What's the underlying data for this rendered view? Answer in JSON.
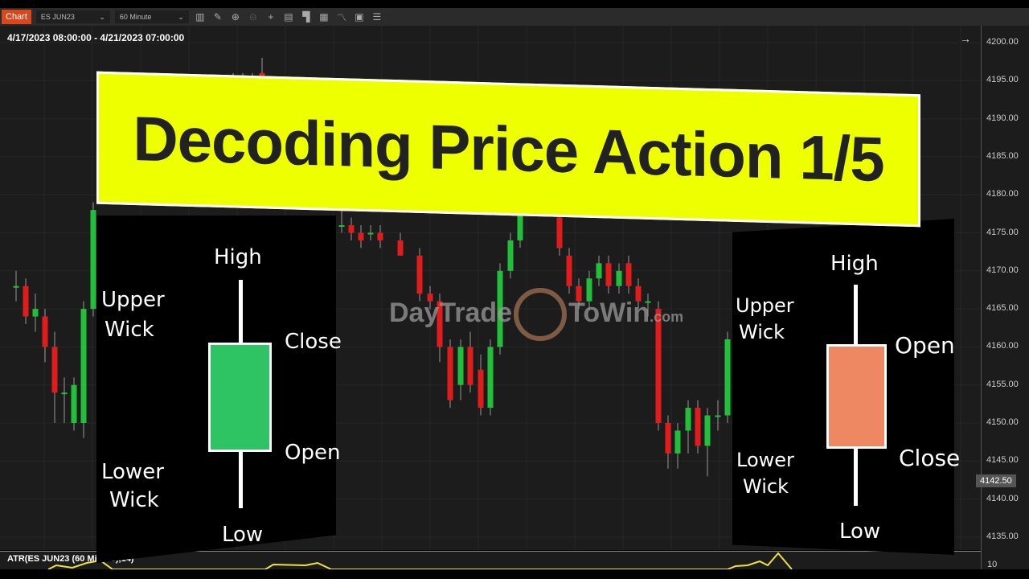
{
  "toolbar": {
    "tab": "Chart",
    "instrument": "ES JUN23",
    "interval": "60 Minute",
    "icons": [
      "bar-type-icon",
      "pencil-icon",
      "zoom-in-icon",
      "zoom-out-icon",
      "crosshair-icon",
      "data-box-icon",
      "properties-icon",
      "strategy-icon",
      "indicator-icon",
      "chart-trader-icon",
      "list-icon"
    ]
  },
  "chart": {
    "range": "4/17/2023 08:00:00 - 4/21/2023 07:00:00",
    "current_price": "4142.50",
    "y_ticks": [
      "4200.00",
      "4195.00",
      "4190.00",
      "4185.00",
      "4180.00",
      "4175.00",
      "4170.00",
      "4165.00",
      "4160.00",
      "4155.00",
      "4150.00",
      "4145.00",
      "4140.00",
      "4135.00"
    ],
    "colors": {
      "up": "#22c03a",
      "down": "#e01c1c",
      "atr": "#f0e040"
    },
    "candles": [
      [
        4168,
        4170,
        4166,
        4168
      ],
      [
        4168,
        4169,
        4163,
        4164
      ],
      [
        4164,
        4167,
        4162,
        4165
      ],
      [
        4164,
        4165,
        4158,
        4160
      ],
      [
        4160,
        4162,
        4150,
        4154
      ],
      [
        4154,
        4156,
        4150,
        4154
      ],
      [
        4150,
        4156,
        4149,
        4155
      ],
      [
        4150,
        4166,
        4148,
        4165
      ],
      [
        4165,
        4179,
        4164,
        4178
      ],
      [
        4194,
        4196,
        4192,
        4195
      ],
      [
        4195,
        4196,
        4193,
        4194
      ],
      [
        4194,
        4196,
        4192,
        4195
      ],
      [
        4196,
        4198,
        4193,
        4194
      ],
      [
        4176,
        4178,
        4175,
        4176
      ],
      [
        4176,
        4177,
        4174,
        4175
      ],
      [
        4175,
        4176,
        4173,
        4174
      ],
      [
        4175,
        4176,
        4174,
        4175
      ],
      [
        4175,
        4176,
        4173,
        4174
      ],
      [
        4174,
        4175,
        4172,
        4172
      ],
      [
        4172,
        4173,
        4166,
        4167
      ],
      [
        4167,
        4168,
        4165,
        4166
      ],
      [
        4166,
        4167,
        4158,
        4160
      ],
      [
        4160,
        4161,
        4152,
        4153
      ],
      [
        4155,
        4161,
        4153,
        4160
      ],
      [
        4160,
        4162,
        4154,
        4155
      ],
      [
        4157,
        4159,
        4151,
        4152
      ],
      [
        4152,
        4161,
        4151,
        4160
      ],
      [
        4160,
        4171,
        4159,
        4170
      ],
      [
        4170,
        4175,
        4169,
        4174
      ],
      [
        4174,
        4179,
        4173,
        4178
      ],
      [
        4177,
        4178,
        4172,
        4173
      ],
      [
        4172,
        4173,
        4167,
        4168
      ],
      [
        4168,
        4169,
        4165,
        4166
      ],
      [
        4166,
        4170,
        4165,
        4169
      ],
      [
        4169,
        4172,
        4168,
        4171
      ],
      [
        4171,
        4172,
        4167,
        4168
      ],
      [
        4168,
        4171,
        4167,
        4170
      ],
      [
        4171,
        4172,
        4167,
        4168
      ],
      [
        4168,
        4169,
        4165,
        4166
      ],
      [
        4166,
        4167,
        4164,
        4166
      ],
      [
        4165,
        4166,
        4149,
        4150
      ],
      [
        4150,
        4151,
        4144,
        4146
      ],
      [
        4146,
        4150,
        4144,
        4149
      ],
      [
        4149,
        4153,
        4146,
        4152
      ],
      [
        4152,
        4153,
        4146,
        4147
      ],
      [
        4147,
        4152,
        4143,
        4151
      ],
      [
        4151,
        4153,
        4149,
        4151
      ],
      [
        4151,
        4162,
        4150,
        4161
      ]
    ],
    "candle_x": [
      20,
      32,
      44,
      56,
      68,
      80,
      92,
      104,
      116,
      290,
      302,
      314,
      326,
      425,
      437,
      449,
      461,
      473,
      498,
      522,
      535,
      547,
      560,
      573,
      585,
      598,
      610,
      622,
      635,
      647,
      696,
      708,
      720,
      733,
      745,
      757,
      770,
      782,
      794,
      806,
      819,
      831,
      843,
      856,
      868,
      880,
      893,
      905
    ]
  },
  "atr": {
    "label": "ATR(ES JUN23 (60 Minute),14)",
    "tick": "10"
  },
  "banner": {
    "title": "Decoding Price Action 1/5"
  },
  "bull": {
    "high": "High",
    "upper": "Upper",
    "wick1": "Wick",
    "close": "Close",
    "open": "Open",
    "lower": "Lower",
    "wick2": "Wick",
    "low": "Low",
    "color": "#2ec464"
  },
  "bear": {
    "high": "High",
    "upper": "Upper",
    "wick1": "Wick",
    "open": "Open",
    "close": "Close",
    "lower": "Lower",
    "wick2": "Wick",
    "low": "Low",
    "color": "#ee8862"
  },
  "logo": {
    "text1": "DayTrade",
    "text2": "ToWin",
    "suffix": ".com"
  }
}
